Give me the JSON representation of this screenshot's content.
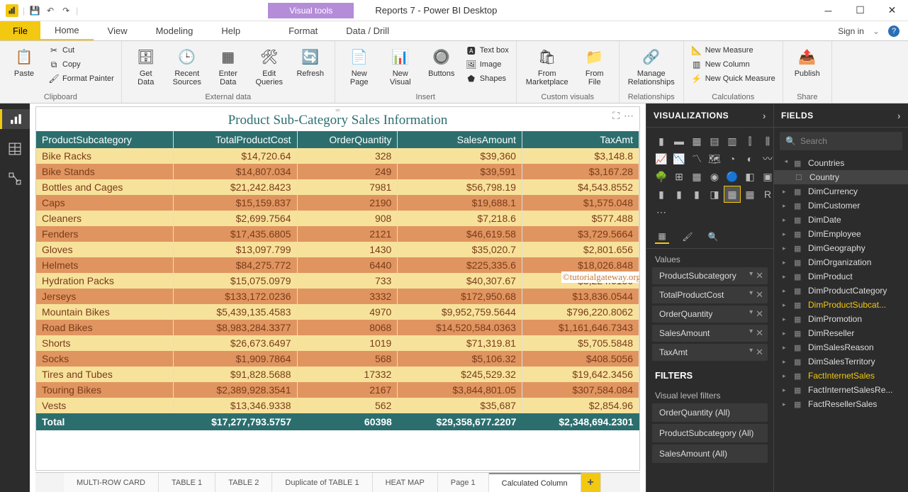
{
  "titlebar": {
    "visual_tools": "Visual tools",
    "app_title": "Reports 7 - Power BI Desktop"
  },
  "ribbon_tabs": {
    "file": "File",
    "home": "Home",
    "view": "View",
    "modeling": "Modeling",
    "help": "Help",
    "format": "Format",
    "datadrill": "Data / Drill",
    "signin": "Sign in"
  },
  "ribbon": {
    "clipboard": {
      "paste": "Paste",
      "cut": "Cut",
      "copy": "Copy",
      "format_painter": "Format Painter",
      "label": "Clipboard"
    },
    "external": {
      "get_data": "Get\nData",
      "recent": "Recent\nSources",
      "enter": "Enter\nData",
      "edit_q": "Edit\nQueries",
      "refresh": "Refresh",
      "label": "External data"
    },
    "insert": {
      "new_page": "New\nPage",
      "new_visual": "New\nVisual",
      "buttons": "Buttons",
      "textbox": "Text box",
      "image": "Image",
      "shapes": "Shapes",
      "label": "Insert"
    },
    "custom": {
      "marketplace": "From\nMarketplace",
      "file": "From\nFile",
      "label": "Custom visuals"
    },
    "rel": {
      "manage": "Manage\nRelationships",
      "label": "Relationships"
    },
    "calc": {
      "measure": "New Measure",
      "column": "New Column",
      "quick": "New Quick Measure",
      "label": "Calculations"
    },
    "share": {
      "publish": "Publish",
      "label": "Share"
    }
  },
  "visual": {
    "title": "Product Sub-Category Sales Information",
    "headers": [
      "ProductSubcategory",
      "TotalProductCost",
      "OrderQuantity",
      "SalesAmount",
      "TaxAmt"
    ],
    "rows": [
      [
        "Bike Racks",
        "$14,720.64",
        "328",
        "$39,360",
        "$3,148.8"
      ],
      [
        "Bike Stands",
        "$14,807.034",
        "249",
        "$39,591",
        "$3,167.28"
      ],
      [
        "Bottles and Cages",
        "$21,242.8423",
        "7981",
        "$56,798.19",
        "$4,543.8552"
      ],
      [
        "Caps",
        "$15,159.837",
        "2190",
        "$19,688.1",
        "$1,575.048"
      ],
      [
        "Cleaners",
        "$2,699.7564",
        "908",
        "$7,218.6",
        "$577.488"
      ],
      [
        "Fenders",
        "$17,435.6805",
        "2121",
        "$46,619.58",
        "$3,729.5664"
      ],
      [
        "Gloves",
        "$13,097.799",
        "1430",
        "$35,020.7",
        "$2,801.656"
      ],
      [
        "Helmets",
        "$84,275.772",
        "6440",
        "$225,335.6",
        "$18,026.848"
      ],
      [
        "Hydration Packs",
        "$15,075.0979",
        "733",
        "$40,307.67",
        "$3,224.6136"
      ],
      [
        "Jerseys",
        "$133,172.0236",
        "3332",
        "$172,950.68",
        "$13,836.0544"
      ],
      [
        "Mountain Bikes",
        "$5,439,135.4583",
        "4970",
        "$9,952,759.5644",
        "$796,220.8062"
      ],
      [
        "Road Bikes",
        "$8,983,284.3377",
        "8068",
        "$14,520,584.0363",
        "$1,161,646.7343"
      ],
      [
        "Shorts",
        "$26,673.6497",
        "1019",
        "$71,319.81",
        "$5,705.5848"
      ],
      [
        "Socks",
        "$1,909.7864",
        "568",
        "$5,106.32",
        "$408.5056"
      ],
      [
        "Tires and Tubes",
        "$91,828.5688",
        "17332",
        "$245,529.32",
        "$19,642.3456"
      ],
      [
        "Touring Bikes",
        "$2,389,928.3541",
        "2167",
        "$3,844,801.05",
        "$307,584.084"
      ],
      [
        "Vests",
        "$13,346.9338",
        "562",
        "$35,687",
        "$2,854.96"
      ]
    ],
    "total": [
      "Total",
      "$17,277,793.5757",
      "60398",
      "$29,358,677.2207",
      "$2,348,694.2301"
    ]
  },
  "watermark": "©tutorialgateway.org",
  "page_tabs": [
    "MULTI-ROW CARD",
    "TABLE 1",
    "TABLE 2",
    "Duplicate of TABLE 1",
    "HEAT MAP",
    "Page 1",
    "Calculated Column"
  ],
  "viz_pane": {
    "header": "VISUALIZATIONS",
    "values_label": "Values",
    "wells": [
      "ProductSubcategory",
      "TotalProductCost",
      "OrderQuantity",
      "SalesAmount",
      "TaxAmt"
    ],
    "filters_header": "FILTERS",
    "filters_label": "Visual level filters",
    "filters": [
      "OrderQuantity  (All)",
      "ProductSubcategory  (All)",
      "SalesAmount  (All)"
    ]
  },
  "fields_pane": {
    "header": "FIELDS",
    "search_placeholder": "Search",
    "tables": [
      {
        "name": "Countries",
        "expanded": true,
        "children": [
          "Country"
        ]
      },
      {
        "name": "DimCurrency"
      },
      {
        "name": "DimCustomer"
      },
      {
        "name": "DimDate"
      },
      {
        "name": "DimEmployee"
      },
      {
        "name": "DimGeography"
      },
      {
        "name": "DimOrganization"
      },
      {
        "name": "DimProduct"
      },
      {
        "name": "DimProductCategory"
      },
      {
        "name": "DimProductSubcat...",
        "hl": true
      },
      {
        "name": "DimPromotion"
      },
      {
        "name": "DimReseller"
      },
      {
        "name": "DimSalesReason"
      },
      {
        "name": "DimSalesTerritory"
      },
      {
        "name": "FactInternetSales",
        "hl": true
      },
      {
        "name": "FactInternetSalesRe..."
      },
      {
        "name": "FactResellerSales"
      }
    ]
  }
}
